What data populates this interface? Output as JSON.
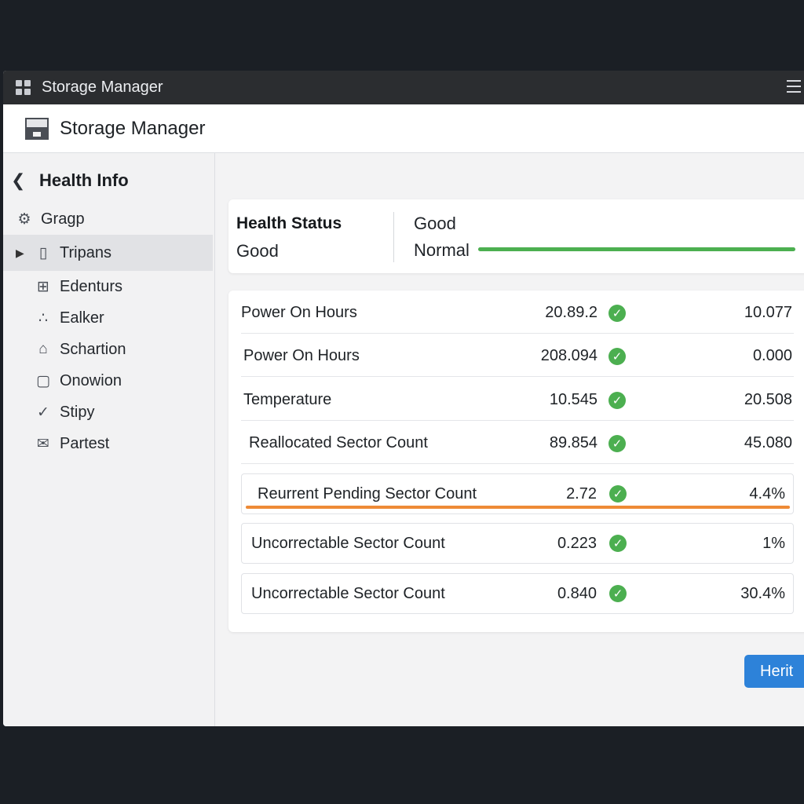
{
  "window": {
    "title": "Storage Manager"
  },
  "header": {
    "title": "Storage Manager"
  },
  "sidebar": {
    "back_label": "Health Info",
    "items": [
      {
        "label": "Gragp",
        "icon": "gear-icon"
      },
      {
        "label": "Tripans",
        "icon": "document-icon",
        "active": true
      },
      {
        "label": "Edenturs",
        "icon": "grid-icon"
      },
      {
        "label": "Ealker",
        "icon": "network-icon"
      },
      {
        "label": "Schartion",
        "icon": "folder-icon"
      },
      {
        "label": "Onowion",
        "icon": "lock-icon"
      },
      {
        "label": "Stipy",
        "icon": "check-circle-icon"
      },
      {
        "label": "Partest",
        "icon": "mail-icon"
      }
    ]
  },
  "status": {
    "heading": "Health Status",
    "value": "Good",
    "right_value": "Good",
    "right_label": "Normal",
    "bar_level": 1.0,
    "bar_color": "#4caf50"
  },
  "attributes": [
    {
      "name": "Power On Hours",
      "value": "20.89.2",
      "threshold": "10.077"
    },
    {
      "name": "Power On Hours",
      "value": "208.094",
      "threshold": "0.000"
    },
    {
      "name": "Temperature",
      "value": "10.545",
      "threshold": "20.508"
    },
    {
      "name": "Reallocated Sector Count",
      "value": "89.854",
      "threshold": "45.080"
    },
    {
      "name": "Reurrent Pending Sector Count",
      "value": "2.72",
      "threshold": "4.4%"
    },
    {
      "name": "Uncorrectable Sector Count",
      "value": "0.223",
      "threshold": "1%"
    },
    {
      "name": "Uncorrectable Sector Count",
      "value": "0.840",
      "threshold": "30.4%"
    }
  ],
  "colors": {
    "ok": "#4caf50",
    "warning": "#ee8a36",
    "accent": "#2d82d9"
  },
  "action_button": {
    "label": "Herit"
  }
}
